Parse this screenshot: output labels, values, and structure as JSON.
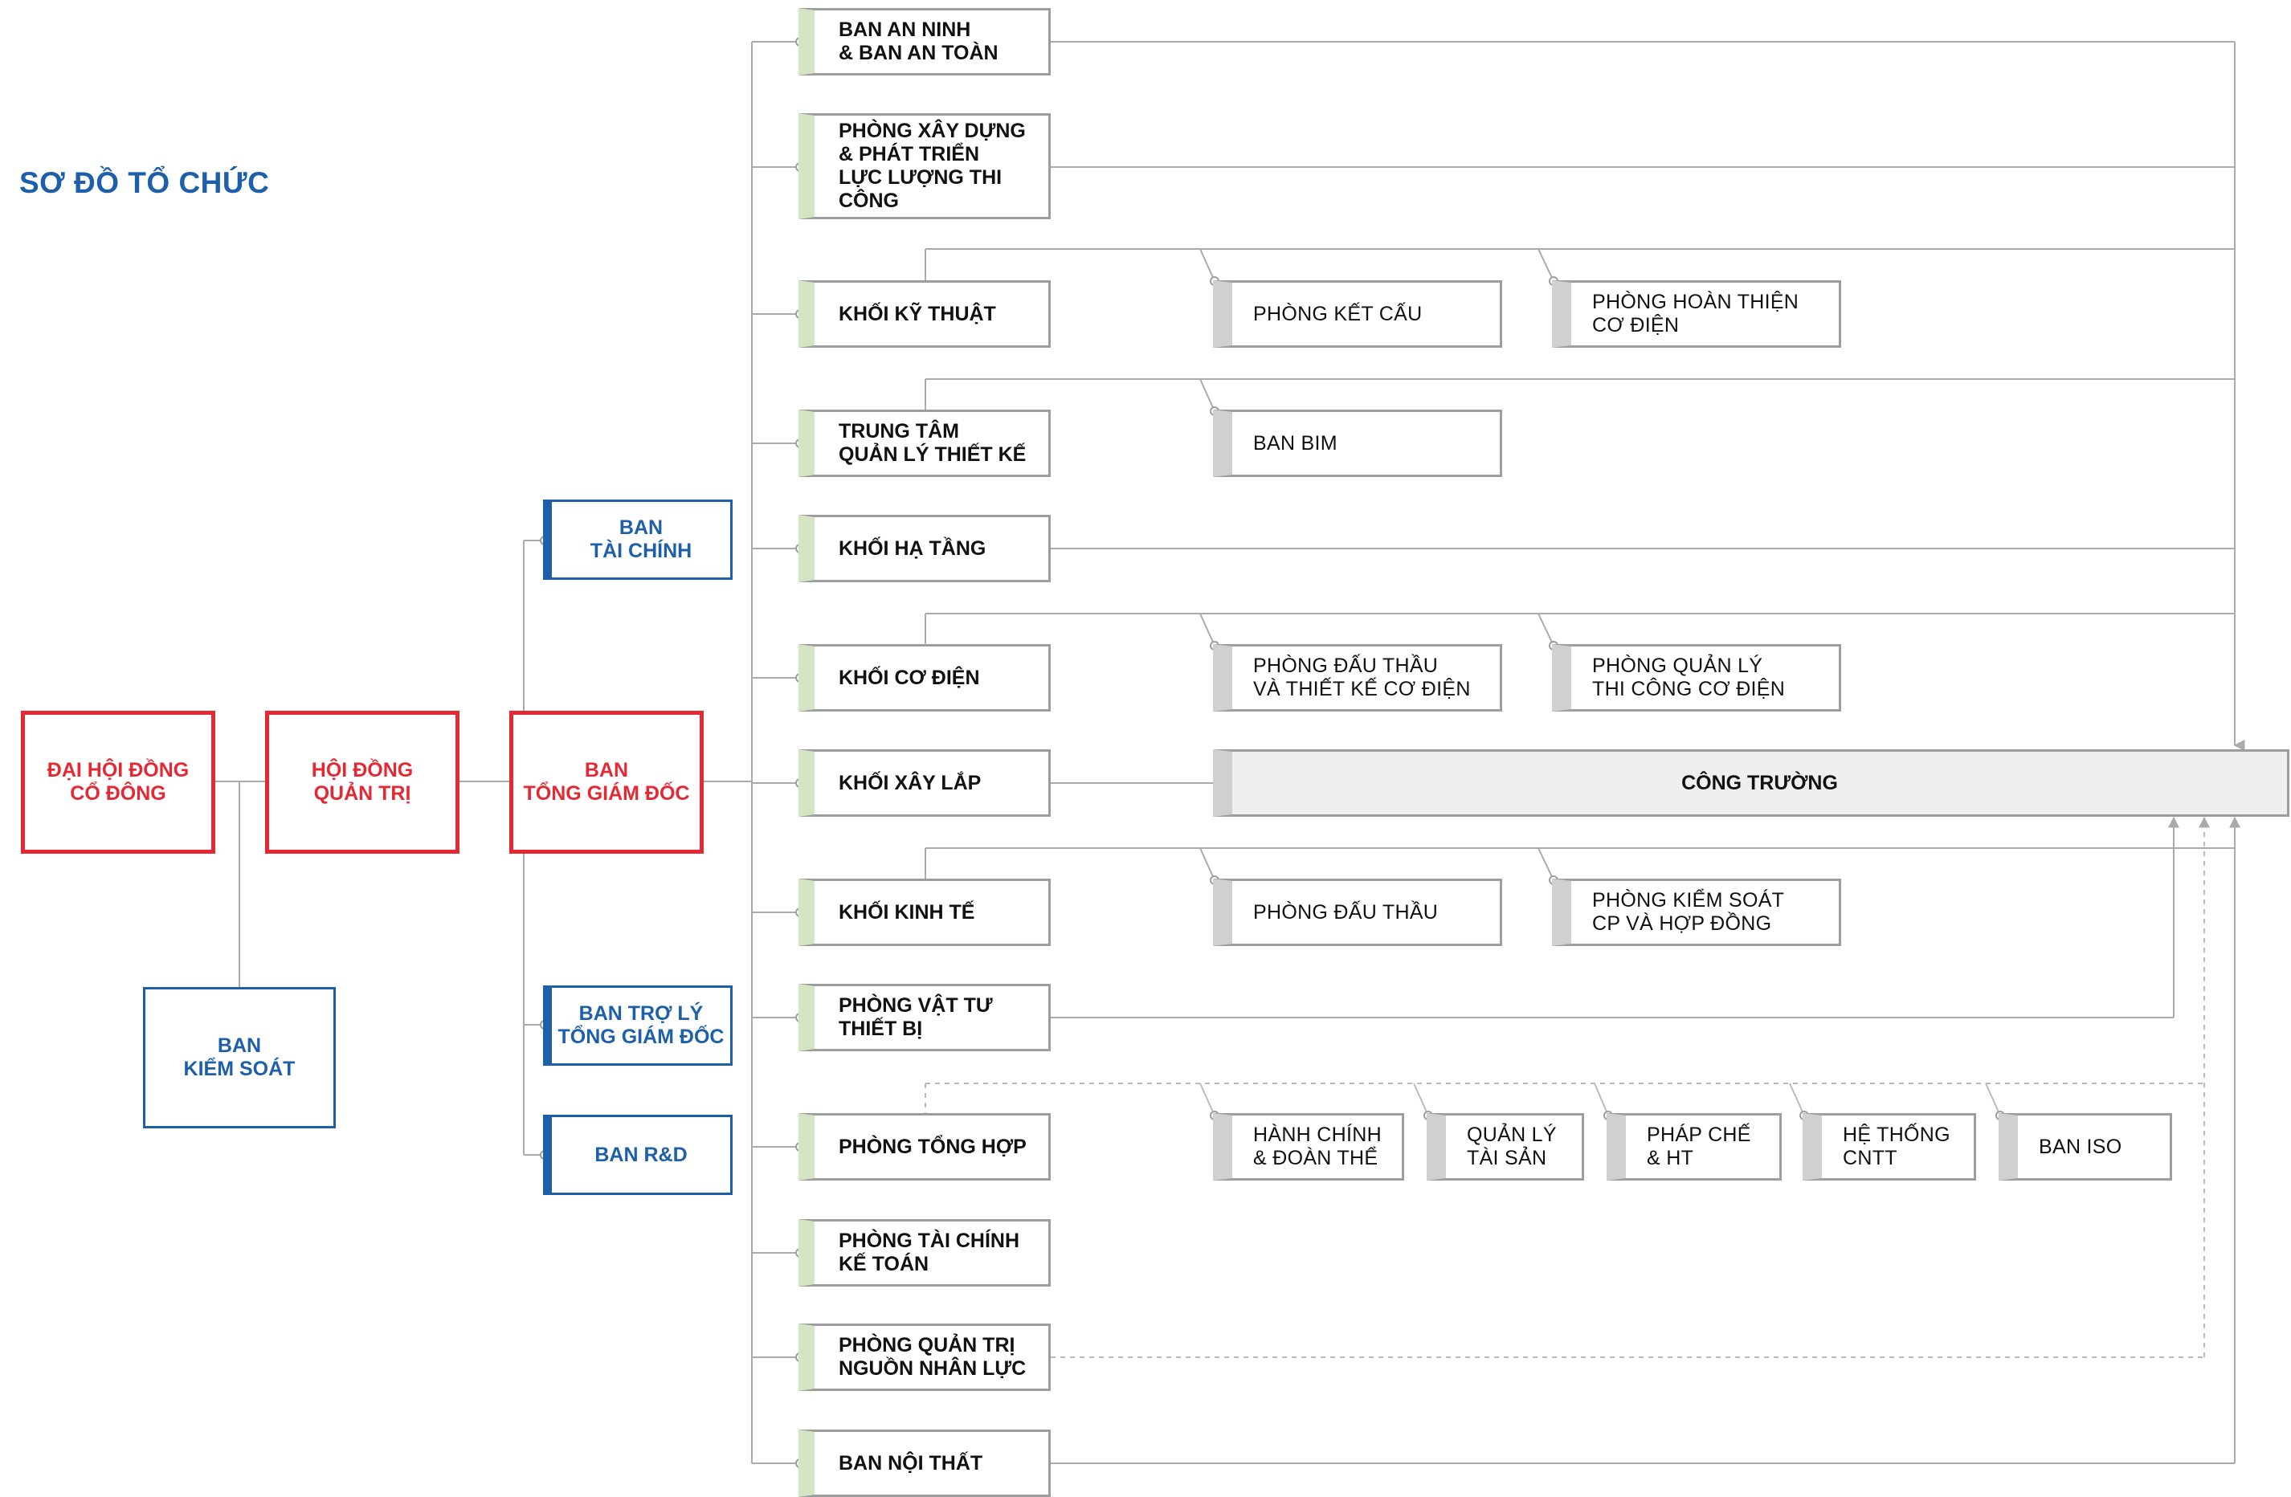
{
  "title": "SƠ ĐỒ TỔ CHỨC",
  "colors": {
    "red": "#e32a34",
    "blue": "#1d5fa8",
    "green_accent": "#d3e5c3",
    "grey_accent": "#d0d0d0",
    "line": "#aaaaaa"
  },
  "governance": {
    "shareholders": "ĐẠI HỘI ĐỒNG\nCỔ ĐÔNG",
    "board": "HỘI ĐỒNG\nQUẢN TRỊ",
    "ceo": "BAN\nTỔNG GIÁM ĐỐC",
    "supervisory": "BAN\nKIỂM SOÁT"
  },
  "staff": {
    "finance_board": "BAN\nTÀI CHÍNH",
    "assistant": "BAN TRỢ LÝ\nTỔNG GIÁM ĐỐC",
    "rnd": "BAN R&D"
  },
  "divisions": {
    "security": "BAN AN NINH\n& BAN AN TOÀN",
    "construction_dev": "PHÒNG XÂY DỰNG\n& PHÁT TRIỂN\nLỰC LƯỢNG THI CÔNG",
    "engineering": "KHỐI KỸ THUẬT",
    "design_center": "TRUNG TÂM\nQUẢN LÝ THIẾT KẾ",
    "infrastructure": "KHỐI HẠ TẦNG",
    "mep": "KHỐI CƠ ĐIỆN",
    "construction": "KHỐI XÂY LẮP",
    "economics": "KHỐI KINH TẾ",
    "materials": "PHÒNG VẬT TƯ\nTHIẾT BỊ",
    "general": "PHÒNG TỔNG HỢP",
    "accounting": "PHÒNG TÀI CHÍNH\nKẾ TOÁN",
    "hr": "PHÒNG QUẢN TRỊ\nNGUỒN NHÂN LỰC",
    "interior": "BAN NỘI THẤT"
  },
  "sub_units": {
    "structure": "PHÒNG KẾT CẤU",
    "finishing_mep": "PHÒNG HOÀN THIỆN\nCƠ ĐIỆN",
    "bim": "BAN BIM",
    "mep_bidding": "PHÒNG ĐẤU THẦU\nVÀ THIẾT KẾ CƠ ĐIỆN",
    "mep_management": "PHÒNG QUẢN LÝ\nTHI CÔNG CƠ ĐIỆN",
    "bidding": "PHÒNG ĐẤU THẦU",
    "cost_control": "PHÒNG KIỂM SOÁT\nCP VÀ HỢP ĐỒNG",
    "admin": "HÀNH CHÍNH\n& ĐOÀN THỂ",
    "assets": "QUẢN LÝ\nTÀI SẢN",
    "legal": "PHÁP CHẾ\n& HT",
    "it": "HỆ THỐNG\nCNTT",
    "iso": "BAN ISO"
  },
  "site": "CÔNG TRƯỜNG"
}
